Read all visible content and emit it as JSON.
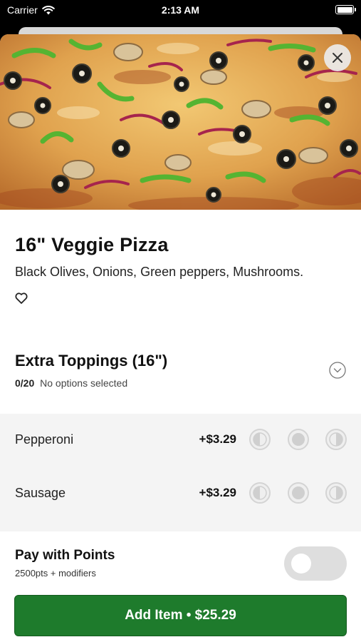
{
  "status_bar": {
    "carrier": "Carrier",
    "time": "2:13 AM"
  },
  "item": {
    "title": "16\" Veggie Pizza",
    "description": "Black Olives, Onions, Green peppers, Mushrooms.",
    "image_icon": "pizza-photo"
  },
  "modifier_group": {
    "title": "Extra Toppings (16\")",
    "count": "0/20",
    "status": "No options selected",
    "options": [
      {
        "name": "Pepperoni",
        "price": "+$3.29"
      },
      {
        "name": "Sausage",
        "price": "+$3.29"
      }
    ]
  },
  "points": {
    "title": "Pay with Points",
    "subtitle": "2500pts + modifiers",
    "enabled": false
  },
  "cta": {
    "label": "Add Item • $25.29"
  },
  "colors": {
    "primary_green": "#1e7b2c",
    "toggle_off": "#dedede",
    "options_bg": "#f4f4f4"
  },
  "icons": [
    "wifi-icon",
    "battery-icon",
    "close-icon",
    "heart-icon",
    "chevron-down-icon",
    "portion-left-icon",
    "portion-whole-icon",
    "portion-right-icon"
  ]
}
